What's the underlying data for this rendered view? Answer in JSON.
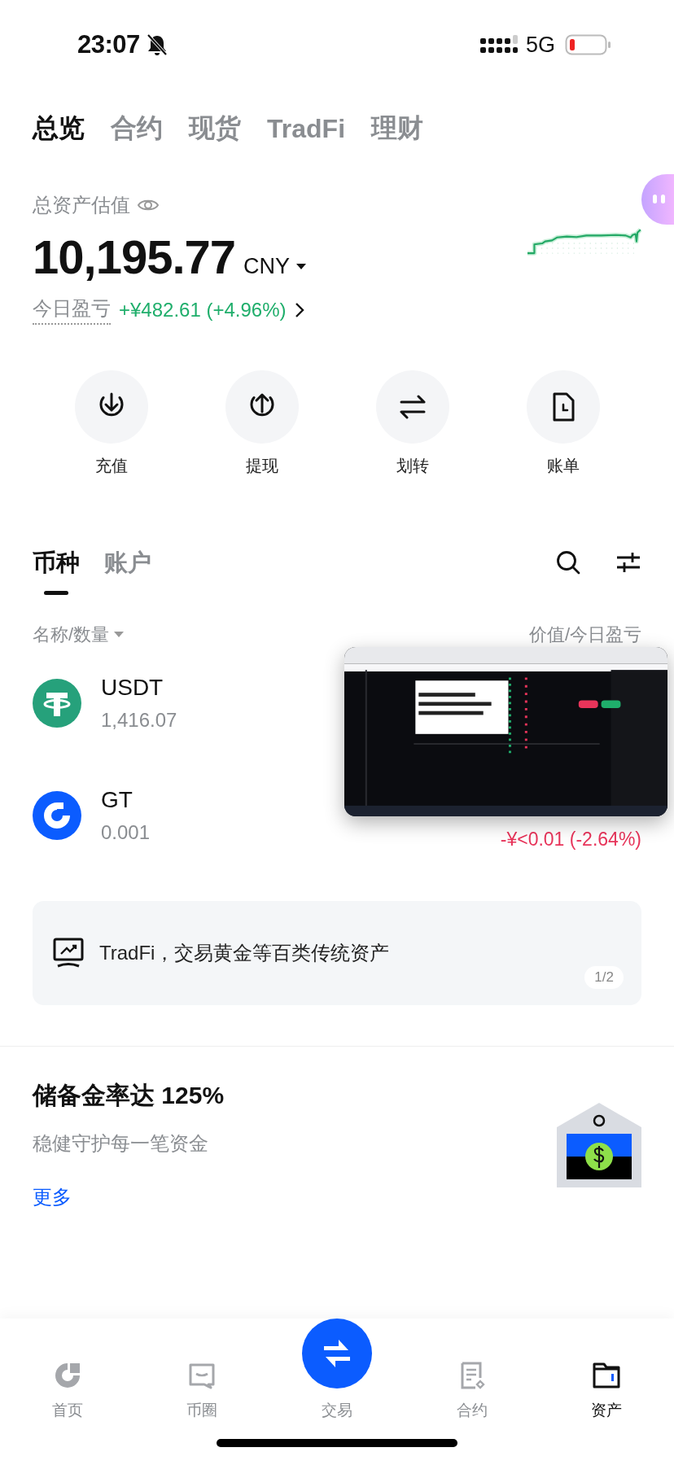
{
  "status_bar": {
    "time": "23:07",
    "network": "5G"
  },
  "top_tabs": [
    {
      "label": "总览",
      "selected": true
    },
    {
      "label": "合约",
      "selected": false
    },
    {
      "label": "现货",
      "selected": false
    },
    {
      "label": "TradFi",
      "selected": false
    },
    {
      "label": "理财",
      "selected": false
    }
  ],
  "summary": {
    "label": "总资产估值",
    "value": "10,195.77",
    "currency": "CNY",
    "pnl_label": "今日盈亏",
    "pnl_value": "+¥482.61 (+4.96%)"
  },
  "actions": [
    {
      "label": "充值",
      "kind": "deposit"
    },
    {
      "label": "提现",
      "kind": "withdraw"
    },
    {
      "label": "划转",
      "kind": "transfer"
    },
    {
      "label": "账单",
      "kind": "bill"
    }
  ],
  "asset_tabs": [
    {
      "label": "币种",
      "selected": true
    },
    {
      "label": "账户",
      "selected": false
    }
  ],
  "list_header": {
    "name": "名称/数量",
    "value": "价值/今日盈亏"
  },
  "assets": [
    {
      "symbol": "USDT",
      "amount": "1,416.07",
      "kind": "tether"
    },
    {
      "symbol": "GT",
      "amount": "0.001",
      "pnl": "-¥<0.01 (-2.64%)",
      "kind": "gate"
    }
  ],
  "banner": {
    "text": "TradFi，交易黄金等百类传统资产",
    "page": "1/2"
  },
  "reserve": {
    "title": "储备金率达 125%",
    "subtitle": "稳健守护每一笔资金",
    "link": "更多"
  },
  "nav": [
    {
      "label": "首页",
      "kind": "home",
      "selected": false
    },
    {
      "label": "币圈",
      "kind": "square",
      "selected": false
    },
    {
      "label": "交易",
      "kind": "trade",
      "selected": false
    },
    {
      "label": "合约",
      "kind": "futures",
      "selected": false
    },
    {
      "label": "资产",
      "kind": "assets",
      "selected": true
    }
  ]
}
